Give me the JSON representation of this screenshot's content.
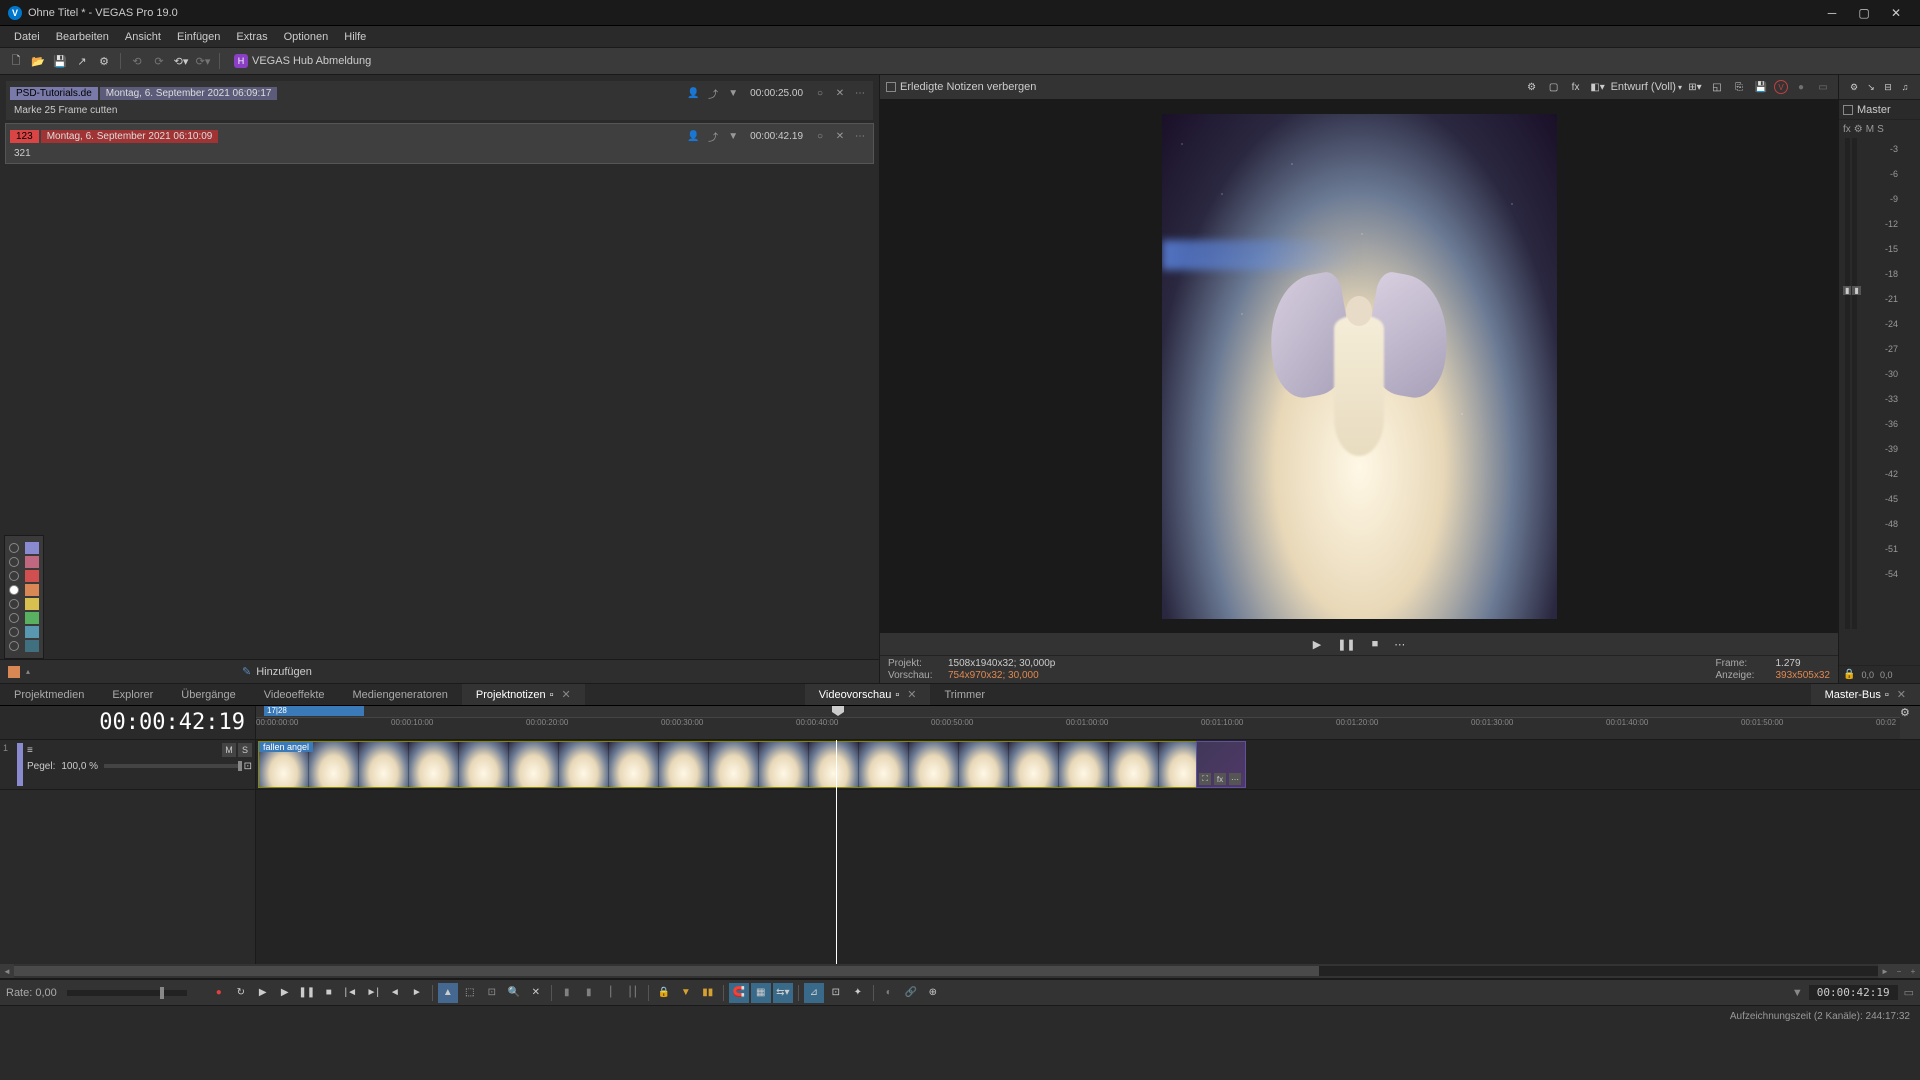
{
  "titlebar": {
    "title": "Ohne Titel * - VEGAS Pro 19.0"
  },
  "menu": {
    "items": [
      "Datei",
      "Bearbeiten",
      "Ansicht",
      "Einfügen",
      "Extras",
      "Optionen",
      "Hilfe"
    ]
  },
  "toolbar": {
    "hub_label": "VEGAS Hub Abmeldung"
  },
  "notes": {
    "hide_done_label": "Erledigte Notizen verbergen",
    "items": [
      {
        "tag": "PSD-Tutorials.de",
        "date": "Montag, 6. September 2021 06:09:17",
        "time": "00:00:25.00",
        "body": "Marke 25 Frame cutten",
        "tag_class": ""
      },
      {
        "tag": "123",
        "date": "Montag, 6. September 2021 06:10:09",
        "time": "00:00:42.19",
        "body": "321",
        "tag_class": "red"
      }
    ],
    "add_label": "Hinzufügen",
    "colors": [
      "#8a8ad0",
      "#c06880",
      "#d05050",
      "#d98855",
      "#d8c050",
      "#58b060",
      "#5898b0",
      "#407080",
      "#d98855"
    ]
  },
  "dock": {
    "left_tabs": [
      "Projektmedien",
      "Explorer",
      "Übergänge",
      "Videoeffekte",
      "Mediengeneratoren"
    ],
    "active_tab": "Projektnotizen",
    "right_tabs": [
      "Videovorschau",
      "Trimmer"
    ],
    "right2": "Master-Bus"
  },
  "preview": {
    "quality": "Entwurf (Voll)",
    "project_lbl": "Projekt:",
    "project_val": "1508x1940x32; 30,000p",
    "preview_lbl": "Vorschau:",
    "preview_val": "754x970x32; 30,000",
    "frame_lbl": "Frame:",
    "frame_val": "1.279",
    "display_lbl": "Anzeige:",
    "display_val": "393x505x32"
  },
  "meter": {
    "title": "Master",
    "sub": [
      "fx",
      "⚙",
      "M",
      "S"
    ],
    "ticks": [
      "-3",
      "-6",
      "-9",
      "-12",
      "-15",
      "-18",
      "-21",
      "-24",
      "-27",
      "-30",
      "-33",
      "-36",
      "-39",
      "-42",
      "-45",
      "-48",
      "-51",
      "-54"
    ],
    "bottom": [
      "0,0",
      "0,0"
    ]
  },
  "timeline": {
    "timecode": "00:00:42:19",
    "marker": "17|28",
    "ruler": [
      "00:00:00:00",
      "00:00:10:00",
      "00:00:20:00",
      "00:00:30:00",
      "00:00:40:00",
      "00:00:50:00",
      "00:01:00:00",
      "00:01:10:00",
      "00:01:20:00",
      "00:01:30:00",
      "00:01:40:00",
      "00:01:50:00",
      "00:02"
    ],
    "track": {
      "num": "1",
      "pegel_lbl": "Pegel:",
      "pegel_val": "100,0 %",
      "ms": [
        "M",
        "S"
      ]
    },
    "clip_name": "fallen angel"
  },
  "rate": {
    "label": "Rate: 0,00"
  },
  "transport": {
    "time": "00:00:42:19"
  },
  "status": {
    "text": "Aufzeichnungszeit (2 Kanäle): 244:17:32"
  }
}
